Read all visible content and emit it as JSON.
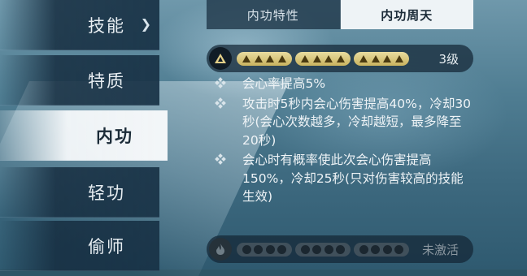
{
  "menu": {
    "items": [
      {
        "label": "技能",
        "active": false
      },
      {
        "label": "特质",
        "active": false
      },
      {
        "label": "内功",
        "active": true
      },
      {
        "label": "轻功",
        "active": false
      },
      {
        "label": "偷师",
        "active": false
      }
    ]
  },
  "tabs": [
    "内功特性",
    "内功周天"
  ],
  "active_tab": "内功周天",
  "level_row": {
    "level_label": "3级",
    "filled_groups": 3,
    "icon": "gold-triangle-icon"
  },
  "effects": [
    "会心率提高5%",
    "攻击时5秒内会心伤害提高40%，冷却30秒(会心次数越多，冷却越短，最多降至20秒)",
    "会心时有概率使此次会心伤害提高150%，冷却25秒(只对伤害较高的技能生效)"
  ],
  "locked_row": {
    "status_label": "未激活",
    "icon": "flame-icon"
  },
  "colors": {
    "gold": "#d8c77a",
    "panel_dark": "#14263a",
    "active_bg": "#f3f6f8",
    "text_light": "#eef3f6",
    "muted": "#8b97a0"
  }
}
